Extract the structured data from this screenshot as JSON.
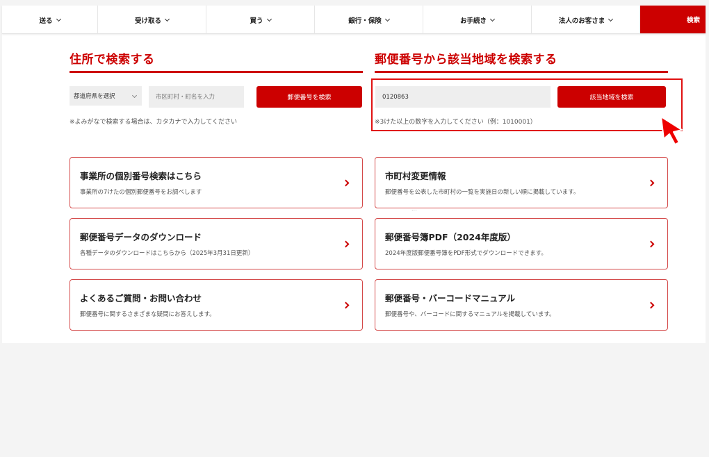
{
  "nav": {
    "items": [
      {
        "label": "送る"
      },
      {
        "label": "受け取る"
      },
      {
        "label": "買う"
      },
      {
        "label": "銀行・保険"
      },
      {
        "label": "お手続き"
      },
      {
        "label": "法人のお客さま"
      }
    ],
    "search_label": "検索"
  },
  "address_search": {
    "title": "住所で検索する",
    "prefecture_select": "都道府県を選択",
    "city_placeholder": "市区町村・町名を入力",
    "button": "郵便番号を検索",
    "note": "※よみがなで検索する場合は、カタカナで入力してください"
  },
  "zip_search": {
    "title": "郵便番号から該当地域を検索する",
    "zip_value": "0120863",
    "button": "該当地域を検索",
    "note": "※3けた以上の数字を入力してください（例：1010001）"
  },
  "cards": [
    {
      "title": "事業所の個別番号検索はこちら",
      "desc": "事業所の7けたの個別郵便番号をお調べします"
    },
    {
      "title": "市町村変更情報",
      "desc": "郵便番号を公表した市町村の一覧を実施日の新しい順に掲載しています。"
    },
    {
      "title": "郵便番号データのダウンロード",
      "desc": "各種データのダウンロードはこちらから（2025年3月31日更新）"
    },
    {
      "title": "郵便番号簿PDF（2024年度版）",
      "desc": "2024年度版郵便番号簿をPDF形式でダウンロードできます。"
    },
    {
      "title": "よくあるご質問・お問い合わせ",
      "desc": "郵便番号に関するさまざまな疑問にお答えします。"
    },
    {
      "title": "郵便番号・バーコードマニュアル",
      "desc": "郵便番号や、バーコードに関するマニュアルを掲載しています。"
    }
  ],
  "colors": {
    "brand_red": "#cc0000"
  }
}
